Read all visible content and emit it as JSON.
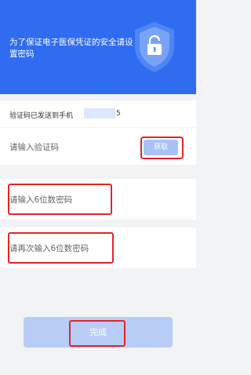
{
  "header": {
    "title": "为了保证电子医保凭证的安全请设置密码",
    "icon": "shield-lock-icon"
  },
  "verification": {
    "sent_label": "验证码已发送到手机",
    "phone_tail": "5",
    "code_placeholder": "请输入验证码",
    "get_button": "获取"
  },
  "password": {
    "placeholder": "请输入6位数密码",
    "confirm_placeholder": "请再次输入6位数密码"
  },
  "submit": {
    "label": "完成"
  },
  "colors": {
    "header_bg": "#2f6cf0",
    "button_disabled": "#b7cdf6",
    "highlight": "#e2242b"
  }
}
